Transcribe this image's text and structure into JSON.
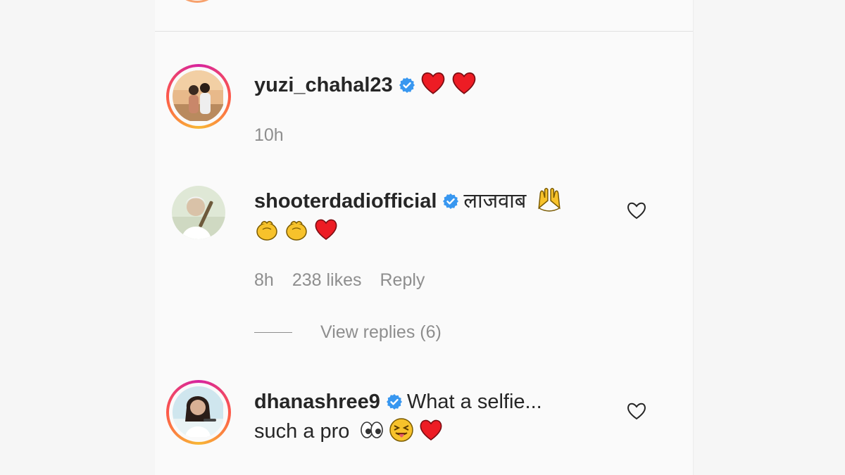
{
  "comments": [
    {
      "username": "yuzi_chahal23",
      "text": "",
      "emojis": [
        "red-heart",
        "red-heart"
      ],
      "time": "10h",
      "likes": "",
      "reply": ""
    },
    {
      "username": "shooterdadiofficial",
      "text": "लाजवाब",
      "emojis_line1": [
        "raising-hands"
      ],
      "emojis_line2": [
        "clapping-hands",
        "clapping-hands",
        "red-heart"
      ],
      "time": "8h",
      "likes": "238 likes",
      "reply": "Reply",
      "view_replies": "View replies (6)"
    },
    {
      "username": "dhanashree9",
      "text": "What a selfie...",
      "text_line2": "such a pro",
      "emojis_line2": [
        "eyes",
        "squinting-tongue-face",
        "red-heart"
      ]
    }
  ],
  "colors": {
    "verified": "#3897f0",
    "heart": "#ed1c24",
    "meta": "#8e8e8e"
  }
}
